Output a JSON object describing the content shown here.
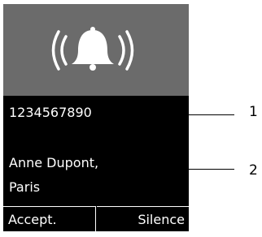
{
  "call": {
    "number": "1234567890",
    "name": "Anne Dupont,",
    "city": "Paris"
  },
  "softkeys": {
    "left_label": "Accept.",
    "right_label": "Silence"
  },
  "callouts": {
    "label_1": "1",
    "label_2": "2"
  },
  "icons": {
    "ringing": "ringing-bell-icon"
  },
  "colors": {
    "screen_background": "#000000",
    "ring_panel_background": "#6b6b6b",
    "text": "#ffffff"
  }
}
